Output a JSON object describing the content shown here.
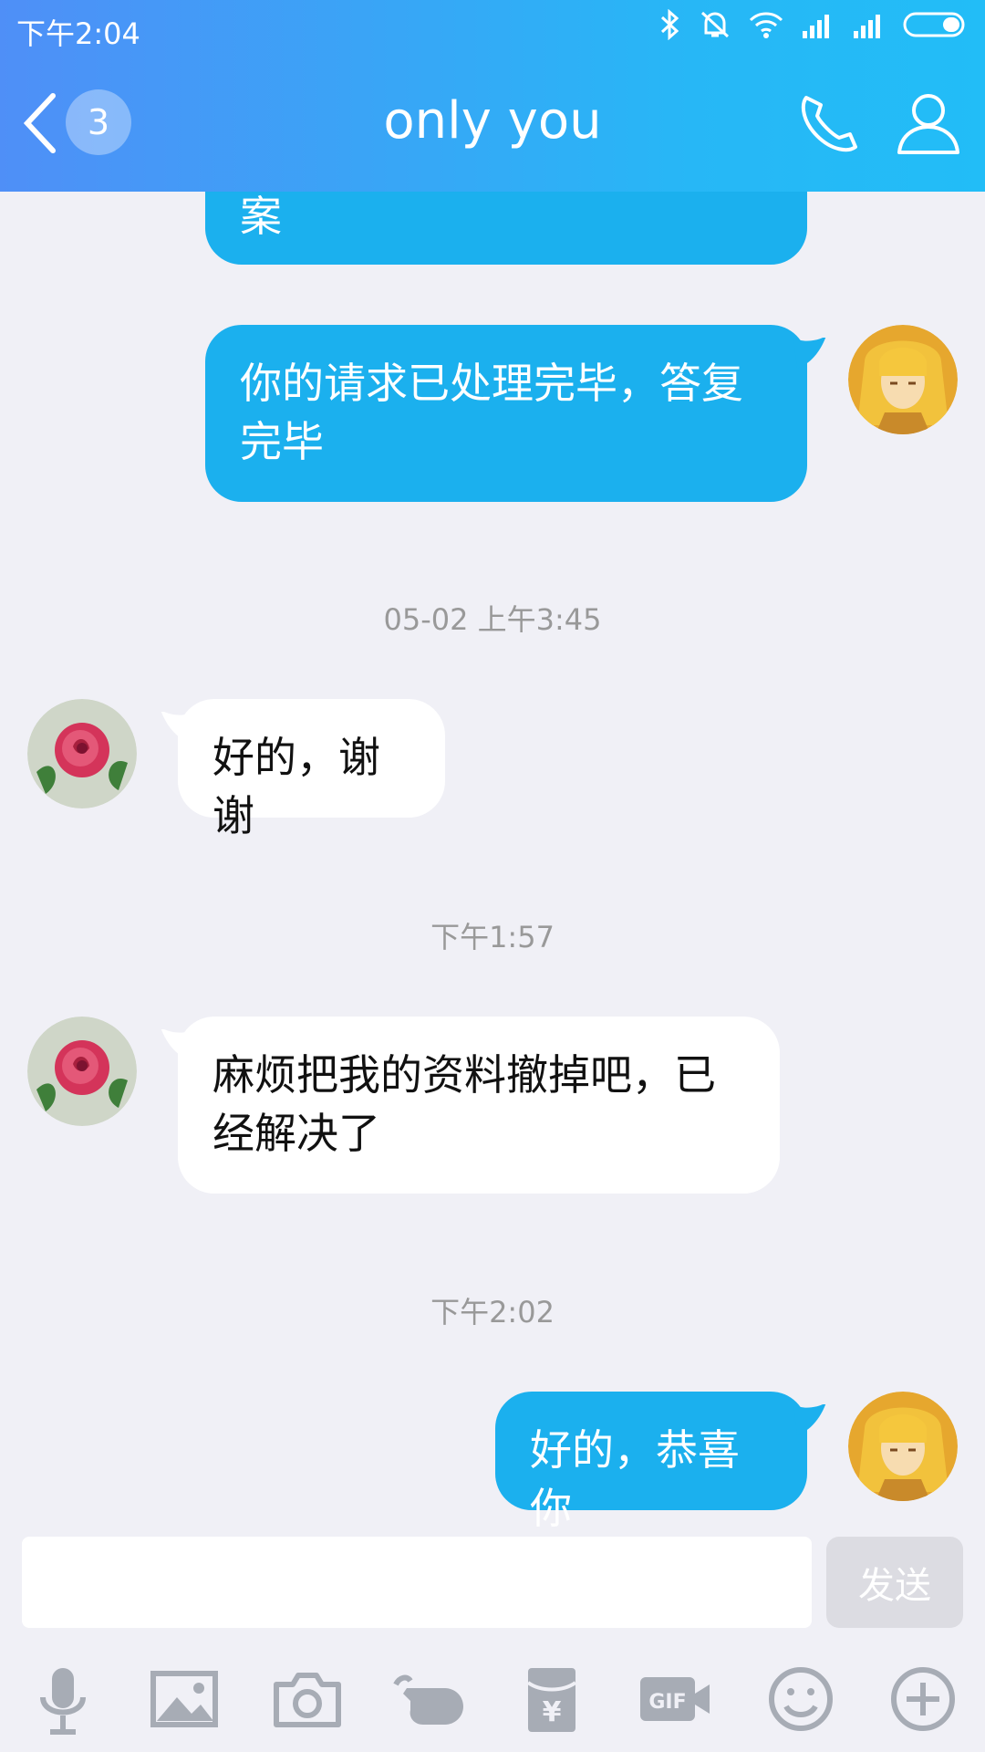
{
  "status_bar": {
    "time": "下午2:04"
  },
  "header": {
    "back_badge": "3",
    "title": "only you"
  },
  "messages": [
    {
      "side": "out",
      "text": "案"
    },
    {
      "side": "out",
      "text": "你的请求已处理完毕，答复完毕"
    },
    {
      "type": "timestamp",
      "text": "05-02 上午3:45"
    },
    {
      "side": "in",
      "text": "好的，谢谢"
    },
    {
      "type": "timestamp",
      "text": "下午1:57"
    },
    {
      "side": "in",
      "text": "麻烦把我的资料撤掉吧，已经解决了"
    },
    {
      "type": "timestamp",
      "text": "下午2:02"
    },
    {
      "side": "out",
      "text": "好的，恭喜你"
    }
  ],
  "input": {
    "value": "",
    "send_label": "发送"
  },
  "toolbar": {
    "icons": [
      "microphone-icon",
      "image-icon",
      "camera-icon",
      "poke-icon",
      "red-packet-icon",
      "gif-icon",
      "emoji-icon",
      "plus-icon"
    ],
    "gif_label": "GIF",
    "yen_label": "¥"
  },
  "colors": {
    "header_start": "#4f8ff7",
    "header_end": "#22bdf7",
    "outgoing_bubble": "#1bb0ee",
    "incoming_bubble": "#ffffff",
    "background": "#f0f0f6"
  }
}
